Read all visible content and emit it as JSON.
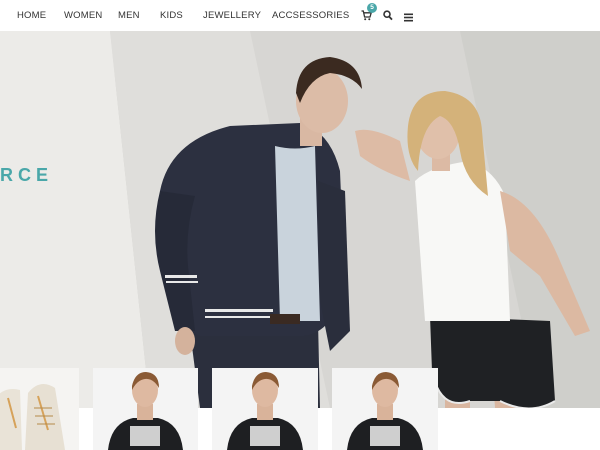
{
  "nav": {
    "items": [
      {
        "id": "home",
        "label": "HOME"
      },
      {
        "id": "women",
        "label": "WOMEN"
      },
      {
        "id": "men",
        "label": "MEN"
      },
      {
        "id": "kids",
        "label": "KIDS"
      },
      {
        "id": "jewellery",
        "label": "JEWELLERY"
      },
      {
        "id": "accessories",
        "label": "ACCSESSORIES"
      }
    ],
    "cart_count": "5",
    "icons": [
      "cart-icon",
      "search-icon",
      "menu-icon"
    ]
  },
  "hero": {
    "partial_text": "RCE",
    "accent_color": "#4aa7a9"
  },
  "products": [
    {
      "name": "sneakers-thumbnail",
      "kind": "shoes"
    },
    {
      "name": "tshirt-thumbnail-1",
      "kind": "model-tshirt"
    },
    {
      "name": "tshirt-thumbnail-2",
      "kind": "model-tshirt"
    },
    {
      "name": "tshirt-thumbnail-3",
      "kind": "model-tshirt"
    }
  ]
}
